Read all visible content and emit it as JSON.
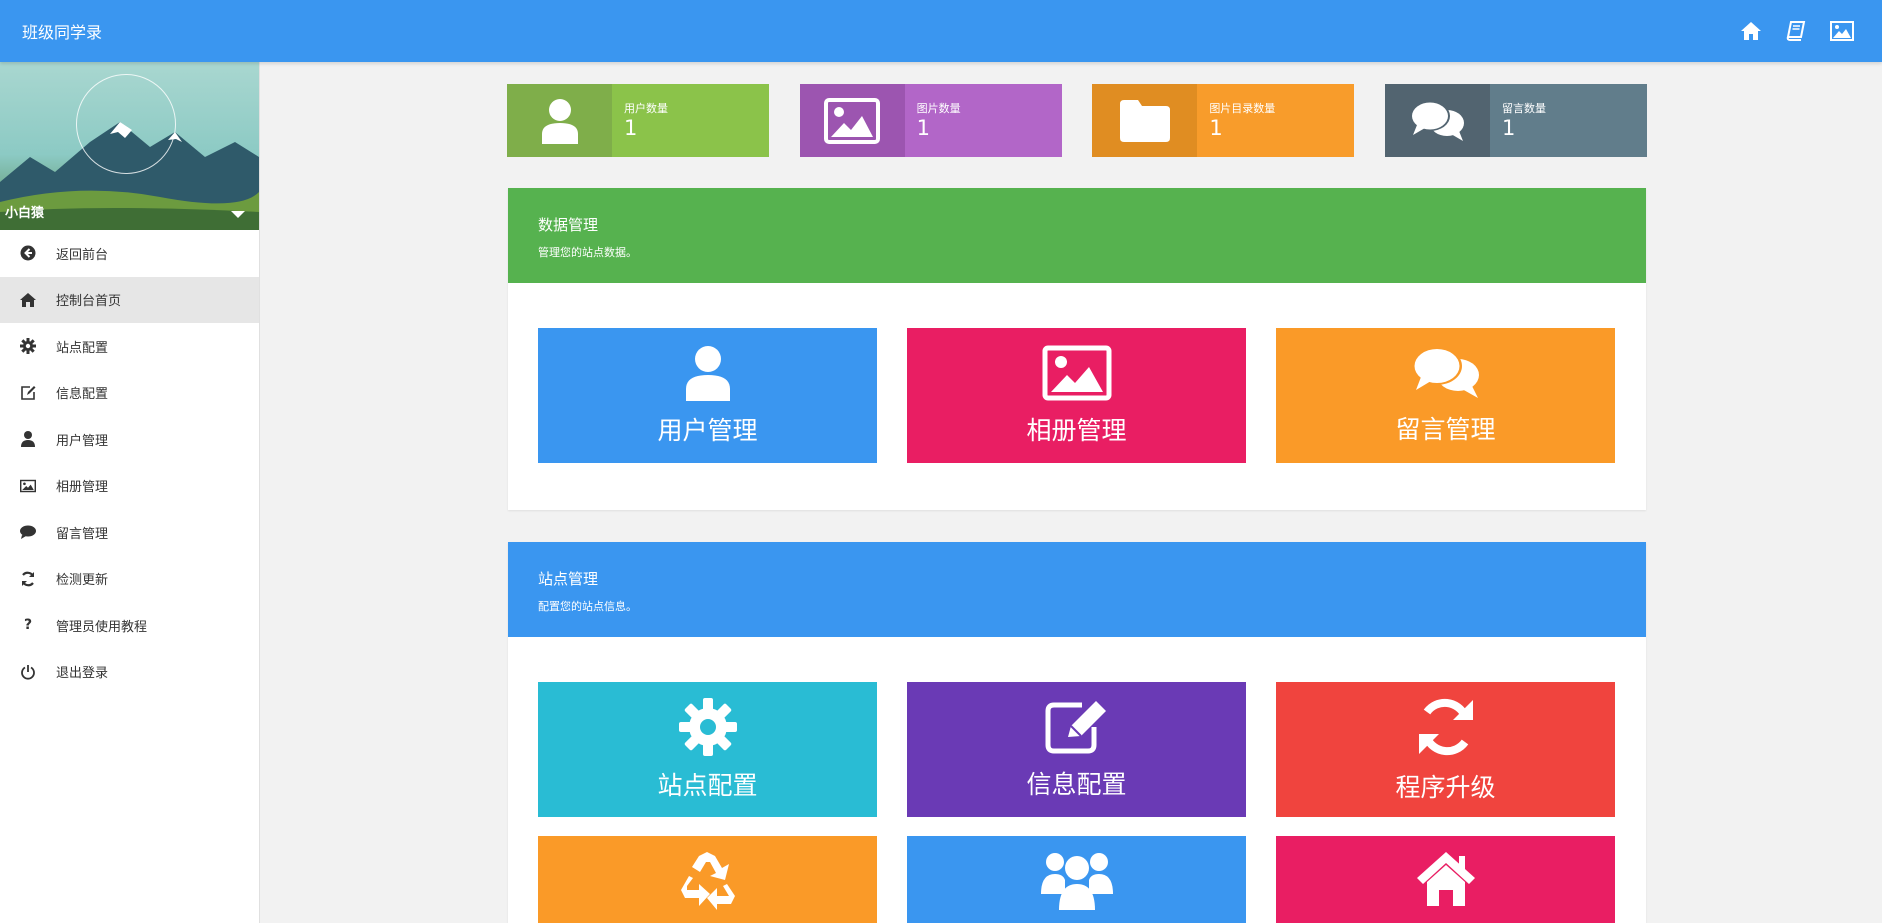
{
  "header": {
    "title": "班级同学录",
    "icons": [
      "home-icon",
      "book-icon",
      "image-icon"
    ]
  },
  "sidebar": {
    "username": "小白猿",
    "items": [
      {
        "label": "返回前台",
        "icon": "arrow-circle-left-icon"
      },
      {
        "label": "控制台首页",
        "icon": "home-icon",
        "active": true
      },
      {
        "label": "站点配置",
        "icon": "gear-icon"
      },
      {
        "label": "信息配置",
        "icon": "edit-icon"
      },
      {
        "label": "用户管理",
        "icon": "user-icon"
      },
      {
        "label": "相册管理",
        "icon": "picture-icon"
      },
      {
        "label": "留言管理",
        "icon": "comment-icon"
      },
      {
        "label": "检测更新",
        "icon": "refresh-icon"
      },
      {
        "label": "管理员使用教程",
        "icon": "question-icon"
      },
      {
        "label": "退出登录",
        "icon": "power-icon"
      }
    ]
  },
  "stats": [
    {
      "label": "用户数量",
      "value": "1",
      "icon": "user-icon",
      "color_dark": "#7fae4a",
      "color": "#8bc34a"
    },
    {
      "label": "图片数量",
      "value": "1",
      "icon": "picture-icon",
      "color_dark": "#9c55b0",
      "color": "#b266c8"
    },
    {
      "label": "图片目录数量",
      "value": "1",
      "icon": "folder-icon",
      "color_dark": "#e08d22",
      "color": "#f89c2b"
    },
    {
      "label": "留言数量",
      "value": "1",
      "icon": "comments-icon",
      "color_dark": "#526470",
      "color": "#617d8b"
    }
  ],
  "panels": {
    "data": {
      "title": "数据管理",
      "subtitle": "管理您的站点数据。",
      "color": "#56b24f",
      "tiles": [
        {
          "label": "用户管理",
          "icon": "user-icon",
          "color": "#3a96f0"
        },
        {
          "label": "相册管理",
          "icon": "picture-icon",
          "color": "#e91e63"
        },
        {
          "label": "留言管理",
          "icon": "comments-icon",
          "color": "#fa9a28"
        }
      ]
    },
    "site": {
      "title": "站点管理",
      "subtitle": "配置您的站点信息。",
      "color": "#3a96f0",
      "tiles": [
        {
          "label": "站点配置",
          "icon": "gear-icon",
          "color": "#29bcd4"
        },
        {
          "label": "信息配置",
          "icon": "edit-icon",
          "color": "#6a3ab5"
        },
        {
          "label": "程序升级",
          "icon": "refresh-icon",
          "color": "#f0443e"
        },
        {
          "label": "",
          "icon": "recycle-icon",
          "color": "#fa9a28"
        },
        {
          "label": "",
          "icon": "users-icon",
          "color": "#3a96f0"
        },
        {
          "label": "",
          "icon": "house-icon",
          "color": "#e91e63"
        }
      ]
    }
  }
}
